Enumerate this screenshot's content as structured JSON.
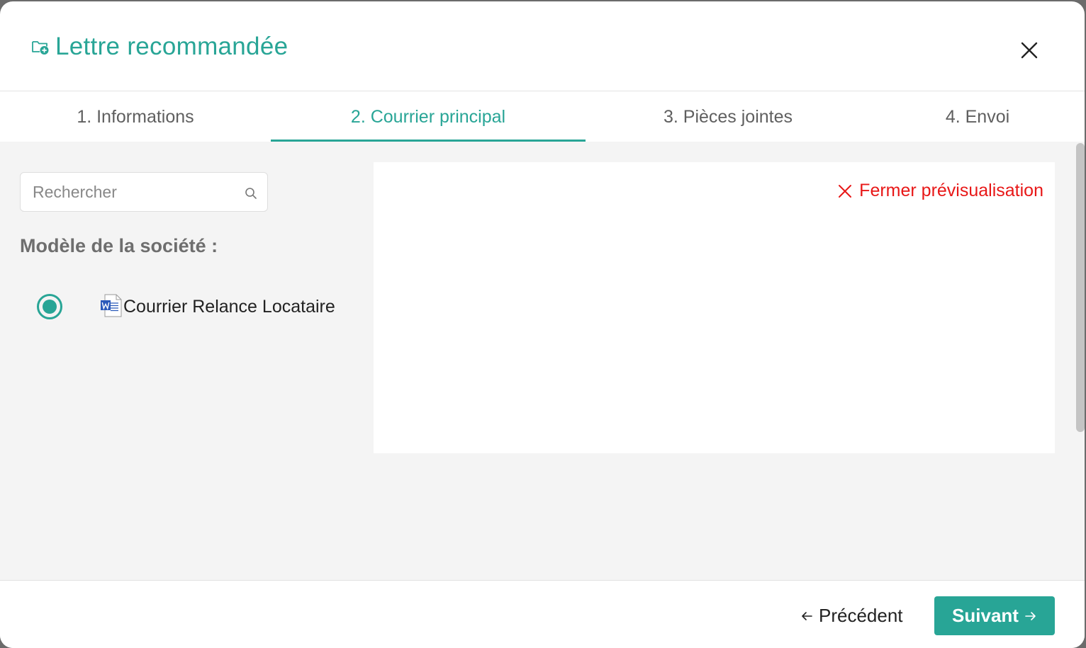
{
  "dialog": {
    "title": "Lettre recommandée",
    "title_icon": "folder-plus-icon",
    "close_icon": "close-icon"
  },
  "tabs": [
    {
      "label": "1. Informations",
      "active": false
    },
    {
      "label": "2. Courrier principal",
      "active": true
    },
    {
      "label": "3. Pièces jointes",
      "active": false
    },
    {
      "label": "4. Envoi",
      "active": false
    }
  ],
  "search": {
    "placeholder": "Rechercher",
    "value": "",
    "icon": "search-icon"
  },
  "models": {
    "section_title": "Modèle de la société :",
    "items": [
      {
        "name": "Courrier Relance Locataire",
        "selected": true,
        "icon": "word-document-icon"
      }
    ]
  },
  "preview": {
    "close_label": "Fermer prévisualisation",
    "close_icon": "close-icon"
  },
  "footer": {
    "prev_label": "Précédent",
    "next_label": "Suivant"
  },
  "colors": {
    "accent": "#28a596",
    "danger": "#e81717",
    "panel_bg": "#f4f4f4",
    "word_blue": "#2b5aba"
  }
}
